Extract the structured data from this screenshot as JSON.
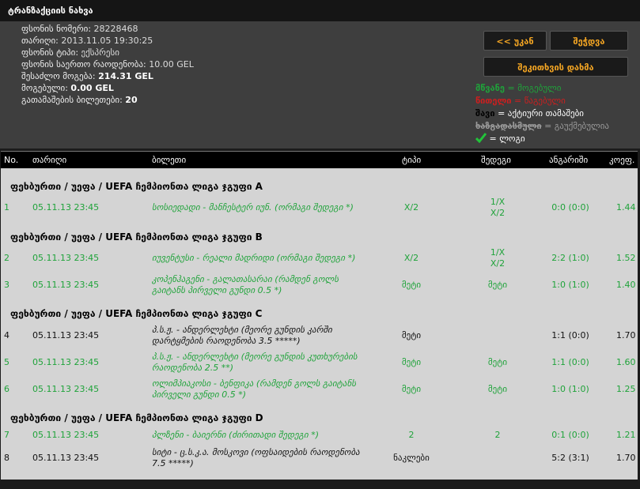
{
  "window": {
    "title": "ტრანზაქციის ნახვა"
  },
  "info": {
    "slip_number_label": "ფსონის ნომერი:",
    "slip_number": "28228468",
    "date_label": "თარიღი:",
    "date": "2013.11.05 19:30:25",
    "type_label": "ფსონის ტიპი:",
    "type": "ექსპრესი",
    "total_stake_label": "ფსონის საერთო რაოდენობა:",
    "total_stake": "10.00 GEL",
    "possible_win_label": "შესაძლო მოგება:",
    "possible_win": "214.31 GEL",
    "won_label": "მოგებული:",
    "won": "0.00 GEL",
    "tickets_label": "გათამაშების ბილეთები:",
    "tickets": "20"
  },
  "buttons": {
    "back": "<< უკან",
    "check": "შეჭდვა",
    "print": "შეკითხვის დახმა"
  },
  "legend": {
    "green_word": "მწვანე",
    "green_desc": "= მოგებული",
    "red_word": "წითელი",
    "red_desc": "= წაგებული",
    "black_word": "შავი",
    "black_desc": "= აქტიური თამაშები",
    "grey_word": "ხაზგადასმული",
    "grey_desc": "= გაუქმებულია",
    "check_desc": "= ლოგი"
  },
  "colors": {
    "green": "#1fa33a",
    "red": "#cc1f1f",
    "accent": "#f5a623",
    "grey": "#9a9a9a"
  },
  "table": {
    "headers": [
      "No.",
      "თარიღი",
      "ბილეთი",
      "ტიპი",
      "შედეგი",
      "ანგარიში",
      "კოეფ."
    ],
    "groups": [
      {
        "title": "ფეხბურთი / უეფა / UEFA ჩემპიონთა ლიგა ჯგუფი A",
        "rows": [
          {
            "no": "1",
            "date": "05.11.13 23:45",
            "bet": "სოსიედადი - მანჩესტერ იუნ. (ორმაგი შედეგი *)",
            "type": "X/2",
            "result": "1/X\nX/2",
            "score": "0:0 (0:0)",
            "odds": "1.44",
            "status": "green"
          }
        ]
      },
      {
        "title": "ფეხბურთი / უეფა / UEFA ჩემპიონთა ლიგა ჯგუფი B",
        "rows": [
          {
            "no": "2",
            "date": "05.11.13 23:45",
            "bet": "იუვენტუსი - რეალი მადრიდი (ორმაგი შედეგი *)",
            "type": "X/2",
            "result": "1/X\nX/2",
            "score": "2:2 (1:0)",
            "odds": "1.52",
            "status": "green"
          },
          {
            "no": "3",
            "date": "05.11.13 23:45",
            "bet": "კოპენჰაგენი - გალათასარაი (რამდენ გოლს გაიტანს პირველი გუნდი 0.5 *)",
            "type": "მეტი",
            "result": "მეტი",
            "score": "1:0 (1:0)",
            "odds": "1.40",
            "status": "green"
          }
        ]
      },
      {
        "title": "ფეხბურთი / უეფა / UEFA ჩემპიონთა ლიგა ჯგუფი C",
        "rows": [
          {
            "no": "4",
            "date": "05.11.13 23:45",
            "bet": "პ.ს.ჟ. - ანდერლეხტი (მეორე გუნდის კარში დარტყმების რაოდენობა 3.5 *****)",
            "type": "მეტი",
            "result": "",
            "score": "1:1 (0:0)",
            "odds": "1.70",
            "status": "black"
          },
          {
            "no": "5",
            "date": "05.11.13 23:45",
            "bet": "პ.ს.ჟ. - ანდერლეხტი (მეორე გუნდის კუთხურების რაოდენობა 2.5 **)",
            "type": "მეტი",
            "result": "მეტი",
            "score": "1:1 (0:0)",
            "odds": "1.60",
            "status": "green"
          },
          {
            "no": "6",
            "date": "05.11.13 23:45",
            "bet": "ოლიმპიაკოსი - ბენფიკა (რამდენ გოლს გაიტანს პირველი გუნდი 0.5 *)",
            "type": "მეტი",
            "result": "მეტი",
            "score": "1:0 (1:0)",
            "odds": "1.25",
            "status": "green"
          }
        ]
      },
      {
        "title": "ფეხბურთი / უეფა / UEFA ჩემპიონთა ლიგა ჯგუფი D",
        "rows": [
          {
            "no": "7",
            "date": "05.11.13 23:45",
            "bet": "პლზენი - ბაიერნი (ძირითადი შედეგი *)",
            "type": "2",
            "result": "2",
            "score": "0:1 (0:0)",
            "odds": "1.21",
            "status": "green"
          },
          {
            "no": "8",
            "date": "05.11.13 23:45",
            "bet": "სიტი - ც.ს.კ.ა. მოსკოვი (ოფსაიდების რაოდენობა 7.5 *****)",
            "type": "ნაკლები",
            "result": "",
            "score": "5:2 (3:1)",
            "odds": "1.70",
            "status": "black"
          }
        ]
      }
    ]
  }
}
